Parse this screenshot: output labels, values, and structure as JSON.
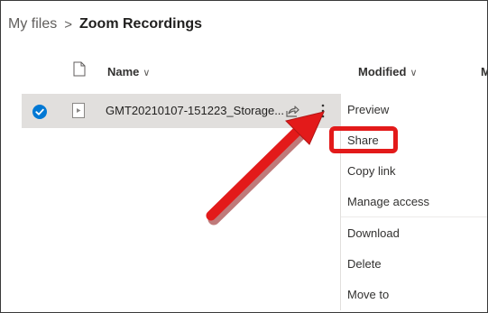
{
  "breadcrumb": {
    "root": "My files",
    "separator": ">",
    "current": "Zoom Recordings"
  },
  "columns": {
    "name": "Name",
    "modified": "Modified",
    "extra": "M"
  },
  "file": {
    "name": "GMT20210107-151223_Storage...",
    "selected": true
  },
  "context_menu": {
    "items": [
      {
        "label": "Preview"
      },
      {
        "label": "Share"
      },
      {
        "label": "Copy link"
      },
      {
        "label": "Manage access"
      },
      {
        "label": "Download"
      },
      {
        "label": "Delete"
      },
      {
        "label": "Move to"
      }
    ]
  },
  "annotation": {
    "highlight_target": "Share",
    "color": "#e31a1a"
  },
  "colors": {
    "accent": "#0078d4",
    "selected_row": "#e1dfdd",
    "annotation_red": "#e31a1a"
  }
}
